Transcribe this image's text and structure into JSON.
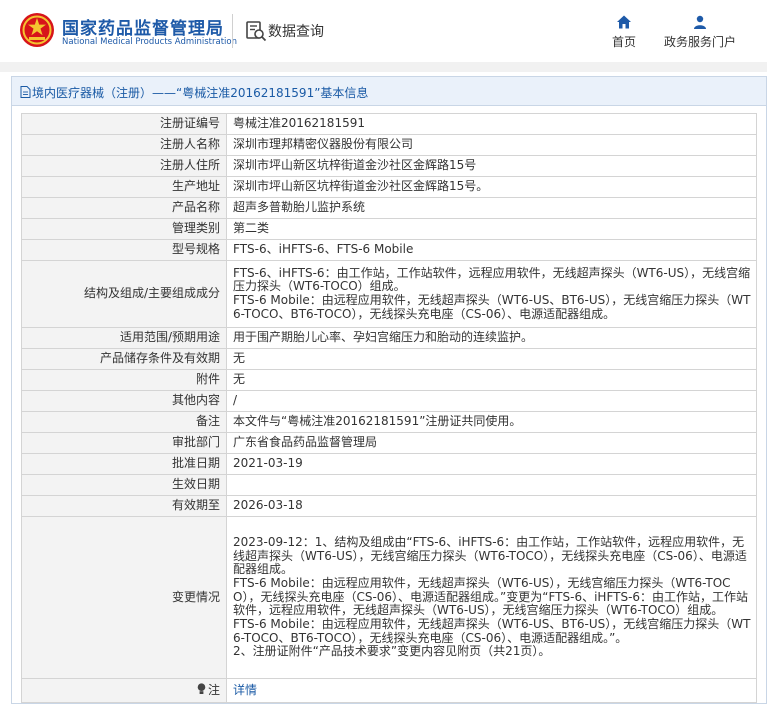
{
  "header": {
    "logo_cn": "国家药品监督管理局",
    "logo_en": "National Medical Products Administration",
    "query_label": "数据查询",
    "nav": [
      {
        "label": "首页",
        "icon": "home-icon"
      },
      {
        "label": "政务服务门户",
        "icon": "user-icon"
      }
    ],
    "brand_color": "#1e5aa8",
    "emblem_color": "#d7141a"
  },
  "panel": {
    "title": "境内医疗器械（注册）——“粤械注准20162181591”基本信息"
  },
  "rows": [
    {
      "label": "注册证编号",
      "value": "粤械注准20162181591"
    },
    {
      "label": "注册人名称",
      "value": "深圳市理邦精密仪器股份有限公司"
    },
    {
      "label": "注册人住所",
      "value": "深圳市坪山新区坑梓街道金沙社区金辉路15号"
    },
    {
      "label": "生产地址",
      "value": "深圳市坪山新区坑梓街道金沙社区金辉路15号。"
    },
    {
      "label": "产品名称",
      "value": "超声多普勒胎儿监护系统"
    },
    {
      "label": "管理类别",
      "value": "第二类"
    },
    {
      "label": "型号规格",
      "value": "FTS-6、iHFTS-6、FTS-6 Mobile"
    },
    {
      "label": "结构及组成/主要组成成分",
      "value": "FTS-6、iHFTS-6：由工作站，工作站软件，远程应用软件，无线超声探头（WT6-US），无线宫缩压力探头（WT6-TOCO）组成。\nFTS-6 Mobile：由远程应用软件，无线超声探头（WT6-US、BT6-US），无线宫缩压力探头（WT6-TOCO、BT6-TOCO），无线探头充电座（CS-06）、电源适配器组成。"
    },
    {
      "label": "适用范围/预期用途",
      "value": "用于围产期胎儿心率、孕妇宫缩压力和胎动的连续监护。"
    },
    {
      "label": "产品储存条件及有效期",
      "value": "无"
    },
    {
      "label": "附件",
      "value": "无"
    },
    {
      "label": "其他内容",
      "value": "/"
    },
    {
      "label": "备注",
      "value": "本文件与“粤械注准20162181591”注册证共同使用。"
    },
    {
      "label": "审批部门",
      "value": "广东省食品药品监督管理局"
    },
    {
      "label": "批准日期",
      "value": "2021-03-19"
    },
    {
      "label": "生效日期",
      "value": ""
    },
    {
      "label": "有效期至",
      "value": "2026-03-18"
    },
    {
      "label": "变更情况",
      "value": "2023-09-12：1、结构及组成由“FTS-6、iHFTS-6：由工作站，工作站软件，远程应用软件，无线超声探头（WT6-US），无线宫缩压力探头（WT6-TOCO），无线探头充电座（CS-06）、电源适配器组成。\nFTS-6 Mobile：由远程应用软件，无线超声探头（WT6-US），无线宫缩压力探头（WT6-TOCO），无线探头充电座（CS-06）、电源适配器组成。”变更为“FTS-6、iHFTS-6：由工作站，工作站软件，远程应用软件，无线超声探头（WT6-US），无线宫缩压力探头（WT6-TOCO）组成。\nFTS-6 Mobile：由远程应用软件，无线超声探头（WT6-US、BT6-US），无线宫缩压力探头（WT6-TOCO、BT6-TOCO），无线探头充电座（CS-06）、电源适配器组成。”。\n2、注册证附件“产品技术要求”变更内容见附页（共21页）。"
    }
  ],
  "note_row": {
    "label": "注",
    "icon": "bulb-icon",
    "link": "详情"
  }
}
